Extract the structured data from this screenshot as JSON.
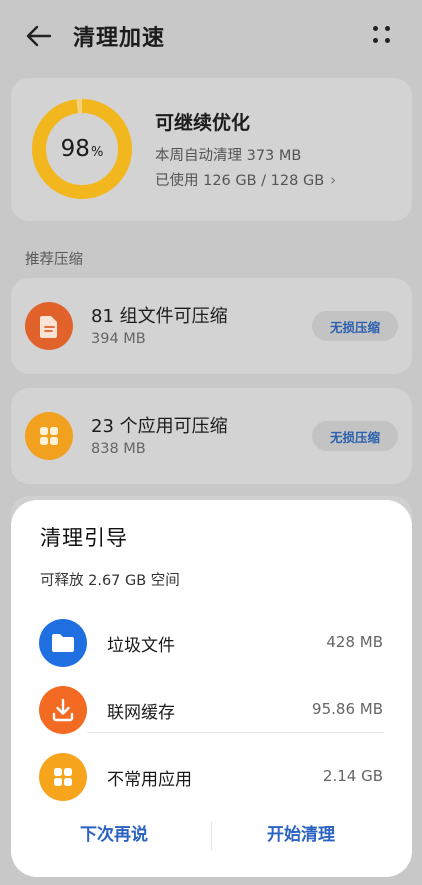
{
  "header": {
    "title": "清理加速"
  },
  "summary": {
    "percent": "98",
    "percent_unit": "%",
    "progress_fraction": 0.98,
    "title": "可继续优化",
    "weekly_cleanup": "本周自动清理 373 MB",
    "storage_used": "已使用 126 GB / 128 GB"
  },
  "section": {
    "label": "推荐压缩"
  },
  "compress": [
    {
      "title": "81 组文件可压缩",
      "size": "394 MB",
      "button": "无损压缩",
      "icon": "file-icon",
      "color": "#e2622c"
    },
    {
      "title": "23 个应用可压缩",
      "size": "838 MB",
      "button": "无损压缩",
      "icon": "apps-grid-icon",
      "color": "#f1a11e"
    }
  ],
  "sheet": {
    "title": "清理引导",
    "subtitle": "可释放 2.67 GB 空间",
    "items": [
      {
        "label": "垃圾文件",
        "value": "428 MB",
        "icon": "folder-icon",
        "color": "#1f6fe0"
      },
      {
        "label": "联网缓存",
        "value": "95.86 MB",
        "icon": "download-icon",
        "color": "#f36b23"
      },
      {
        "label": "不常用应用",
        "value": "2.14 GB",
        "icon": "apps-grid-icon",
        "color": "#f7a51c"
      }
    ],
    "later_button": "下次再说",
    "start_button": "开始清理"
  },
  "colors": {
    "accent": "#2b63c2",
    "ring_track": "#f3d27a",
    "ring_fill": "#f2b61f"
  }
}
